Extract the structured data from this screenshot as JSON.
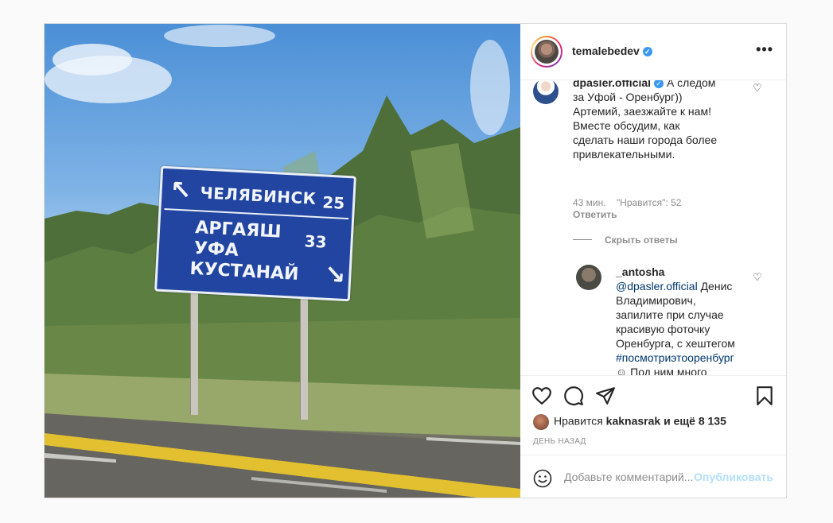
{
  "post": {
    "author": {
      "username": "temalebedev",
      "verified_icon": "verified-badge-icon",
      "more_icon": "more-options-icon"
    },
    "photo": {
      "sign": {
        "top_arrow": "↖",
        "row1_city": "ЧЕЛЯБИНСК",
        "row1_km": "25",
        "row2_city1": "АРГАЯШ",
        "row2_km": "33",
        "row2_city2": "УФА",
        "row2_city3": "КУСТАНАЙ",
        "bottom_arrow": "↘"
      }
    },
    "comments": [
      {
        "username": "dpasler.official",
        "verified": true,
        "text": "А следом за Уфой - Оренбург)) Артемий, заезжайте к нам! Вместе обсудим, как сделать наши города более привлекательными.",
        "time": "43 мин.",
        "likes_label": "\"Нравится\": 52",
        "reply_label": "Ответить",
        "hide_replies_label": "Скрыть ответы"
      },
      {
        "username": "_antosha",
        "mention": "@dpasler.official",
        "text_before_hashtag": " Денис Владимирович, запилите при случае красивую фоточку Оренбурга, с хештегом ",
        "hashtag": "#посмотриэтооренбург",
        "text_after_hashtag": " ☺ Под ним много фотографий"
      }
    ],
    "actions": {
      "like_icon": "heart-icon",
      "comment_icon": "comment-icon",
      "share_icon": "share-icon",
      "save_icon": "bookmark-icon",
      "likes_prefix": "Нравится",
      "likes_user": "kaknasrak",
      "likes_suffix": "и ещё 8 135",
      "date": "ДЕНЬ НАЗАД"
    },
    "add_comment": {
      "emoji_icon": "emoji-icon",
      "placeholder": "Добавьте комментарий...",
      "publish_label": "Опубликовать"
    }
  },
  "colors": {
    "accent": "#3897f0",
    "publish_disabled": "#b2dffc",
    "link": "#00376b",
    "sign_blue": "#2145a0"
  }
}
